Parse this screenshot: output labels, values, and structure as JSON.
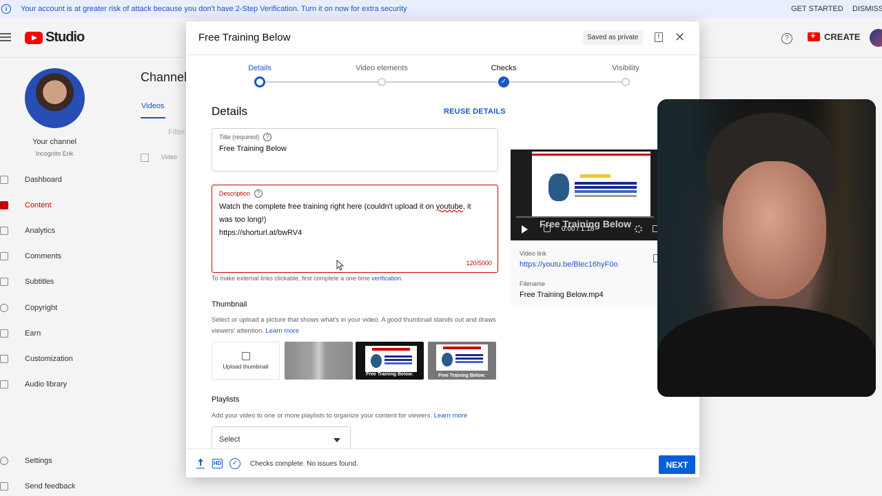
{
  "banner": {
    "message": "Your account is at greater risk of attack because you don't have 2-Step Verification. Turn it on now for extra security",
    "get_started": "GET STARTED",
    "dismiss": "DISMISS"
  },
  "topbar": {
    "brand": "Studio",
    "create_label": "CREATE"
  },
  "sidebar": {
    "channel_title": "Your channel",
    "channel_name": "Incognito Erik",
    "items": [
      {
        "label": "Dashboard"
      },
      {
        "label": "Content"
      },
      {
        "label": "Analytics"
      },
      {
        "label": "Comments"
      },
      {
        "label": "Subtitles"
      },
      {
        "label": "Copyright"
      },
      {
        "label": "Earn"
      },
      {
        "label": "Customization"
      },
      {
        "label": "Audio library"
      }
    ],
    "settings": "Settings",
    "feedback": "Send feedback"
  },
  "background": {
    "channel_heading": "Channel",
    "videos_tab": "Videos",
    "filter": "Filter",
    "video_col": "Video"
  },
  "dialog": {
    "title": "Free Training Below",
    "saved_status": "Saved as private",
    "steps": [
      {
        "label": "Details",
        "state": "active"
      },
      {
        "label": "Video elements",
        "state": "pending"
      },
      {
        "label": "Checks",
        "state": "done"
      },
      {
        "label": "Visibility",
        "state": "pending"
      }
    ],
    "section_heading": "Details",
    "reuse_label": "REUSE DETAILS",
    "title_field": {
      "label": "Title (required)",
      "value": "Free Training Below"
    },
    "description_field": {
      "label": "Description",
      "line1_before": "Watch the complete free training right here (couldn't upload it on ",
      "line1_wavy": "youtube",
      "line1_after": ", it",
      "line2": "was too long!)",
      "line3": "https://shorturl.at/bwRV4",
      "counter": "120/5000"
    },
    "hint_text": "To make external links clickable, first complete a one-time ",
    "hint_link": "verification",
    "hint_end": ".",
    "thumbnail": {
      "heading": "Thumbnail",
      "description": "Select or upload a picture that shows what's in your video. A good thumbnail stands out and draws viewers' attention. ",
      "learn_more": "Learn more",
      "upload_label": "Upload thumbnail",
      "caption": "Free Training Below:"
    },
    "playlists": {
      "heading": "Playlists",
      "description": "Add your video to one or more playlists to organize your content for viewers. ",
      "learn_more": "Learn more",
      "select_value": "Select"
    },
    "preview": {
      "overlay_title": "Free Training Below",
      "time": "0:00 / 1:18",
      "video_link_label": "Video link",
      "video_link": "https://youtu.be/Blec16hyF0o",
      "filename_label": "Filename",
      "filename": "Free Training Below.mp4"
    },
    "footer": {
      "status": "Checks complete. No issues found.",
      "next_label": "NEXT"
    }
  },
  "colors": {
    "accent": "#065fd4",
    "error": "#cc0000",
    "brand_red": "#ff0000"
  }
}
